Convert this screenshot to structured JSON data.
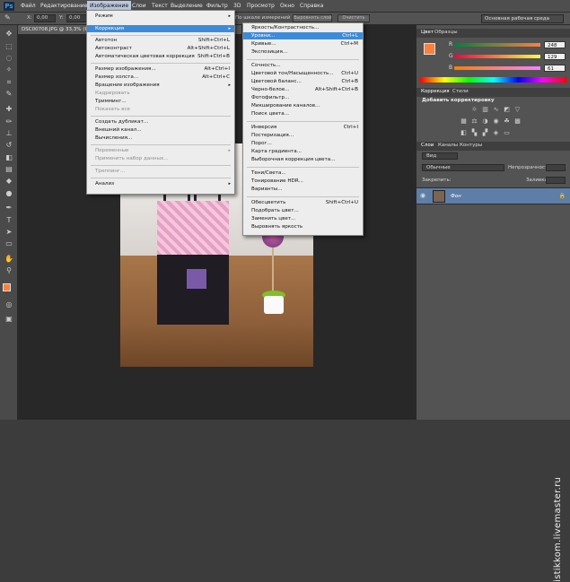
{
  "menubar": {
    "logo": "Ps",
    "items": [
      "Файл",
      "Редактирование",
      "Изображение",
      "Слои",
      "Текст",
      "Выделение",
      "Фильтр",
      "3D",
      "Просмотр",
      "Окно",
      "Справка"
    ]
  },
  "options": {
    "x_label": "X:",
    "x_value": "0,00",
    "y_label": "Y:",
    "y_value": "0,00",
    "sample_text": "По шкале измерений",
    "select_layer_btn": "Выровнять слой",
    "clear_btn": "Очистить",
    "workspace": "Основная рабочая среда"
  },
  "doc_tab": "DSC00708.JPG @ 33,3% (RGB/8*)",
  "image_menu": {
    "items": [
      {
        "label": "Режим",
        "arrow": "▸",
        "shortcut": "",
        "disabled": false
      },
      {
        "label": "Коррекция",
        "arrow": "▸",
        "shortcut": "",
        "disabled": false,
        "active": true
      },
      {
        "label": "Автотон",
        "shortcut": "Shift+Ctrl+L",
        "disabled": false
      },
      {
        "label": "Автоконтраст",
        "shortcut": "Alt+Shift+Ctrl+L",
        "disabled": false
      },
      {
        "label": "Автоматическая цветовая коррекция",
        "shortcut": "Shift+Ctrl+B",
        "disabled": false
      },
      {
        "label": "Размер изображения...",
        "shortcut": "Alt+Ctrl+I",
        "disabled": false
      },
      {
        "label": "Размер холста...",
        "shortcut": "Alt+Ctrl+C",
        "disabled": false
      },
      {
        "label": "Вращение изображения",
        "arrow": "▸",
        "shortcut": "",
        "disabled": false
      },
      {
        "label": "Кадрировать",
        "shortcut": "",
        "disabled": true
      },
      {
        "label": "Тримминг...",
        "shortcut": "",
        "disabled": false
      },
      {
        "label": "Показать все",
        "shortcut": "",
        "disabled": true
      },
      {
        "label": "Создать дубликат...",
        "shortcut": "",
        "disabled": false
      },
      {
        "label": "Внешний канал...",
        "shortcut": "",
        "disabled": false
      },
      {
        "label": "Вычисления...",
        "shortcut": "",
        "disabled": false
      },
      {
        "label": "Переменные",
        "arrow": "▸",
        "shortcut": "",
        "disabled": true
      },
      {
        "label": "Применить набор данных...",
        "shortcut": "",
        "disabled": true
      },
      {
        "label": "Треппинг...",
        "shortcut": "",
        "disabled": true
      },
      {
        "label": "Анализ",
        "arrow": "▸",
        "shortcut": "",
        "disabled": false
      }
    ]
  },
  "correction_menu": {
    "items": [
      {
        "label": "Яркость/Контрастность...",
        "shortcut": ""
      },
      {
        "label": "Уровни...",
        "shortcut": "Ctrl+L",
        "highlighted": true
      },
      {
        "label": "Кривые...",
        "shortcut": "Ctrl+M"
      },
      {
        "label": "Экспозиция...",
        "shortcut": ""
      },
      {
        "label": "Сочность...",
        "shortcut": ""
      },
      {
        "label": "Цветовой тон/Насыщенность...",
        "shortcut": "Ctrl+U"
      },
      {
        "label": "Цветовой баланс...",
        "shortcut": "Ctrl+B"
      },
      {
        "label": "Черно-белое...",
        "shortcut": "Alt+Shift+Ctrl+B"
      },
      {
        "label": "Фотофильтр...",
        "shortcut": ""
      },
      {
        "label": "Микширование каналов...",
        "shortcut": ""
      },
      {
        "label": "Поиск цвета...",
        "shortcut": ""
      },
      {
        "label": "Инверсия",
        "shortcut": "Ctrl+I"
      },
      {
        "label": "Постеризация...",
        "shortcut": ""
      },
      {
        "label": "Порог...",
        "shortcut": ""
      },
      {
        "label": "Карта градиента...",
        "shortcut": ""
      },
      {
        "label": "Выборочная коррекция цвета...",
        "shortcut": ""
      },
      {
        "label": "Тени/Света...",
        "shortcut": ""
      },
      {
        "label": "Тонирование HDR...",
        "shortcut": ""
      },
      {
        "label": "Варианты...",
        "shortcut": ""
      },
      {
        "label": "Обесцветить",
        "shortcut": "Shift+Ctrl+U"
      },
      {
        "label": "Подобрать цвет...",
        "shortcut": ""
      },
      {
        "label": "Заменить цвет...",
        "shortcut": ""
      },
      {
        "label": "Выровнять яркость",
        "shortcut": ""
      }
    ]
  },
  "color_panel": {
    "tabs": [
      "Цвет",
      "Образцы"
    ],
    "r_label": "R",
    "g_label": "G",
    "b_label": "B",
    "r_value": "248",
    "g_value": "129",
    "b_value": "61",
    "fg_color": "#f8813d"
  },
  "adjust_panel": {
    "tabs": [
      "Коррекция",
      "Стили"
    ],
    "title": "Добавить корректировку"
  },
  "layers_panel": {
    "tabs": [
      "Слои",
      "Каналы",
      "Контуры"
    ],
    "kind": "Вид",
    "blend": "Обычные",
    "opacity_label": "Непрозрачность:",
    "lock_label": "Закрепить:",
    "fill_label": "Заливка:",
    "layer_name": "Фон"
  },
  "watermark": "istikkom.livemaster.ru"
}
